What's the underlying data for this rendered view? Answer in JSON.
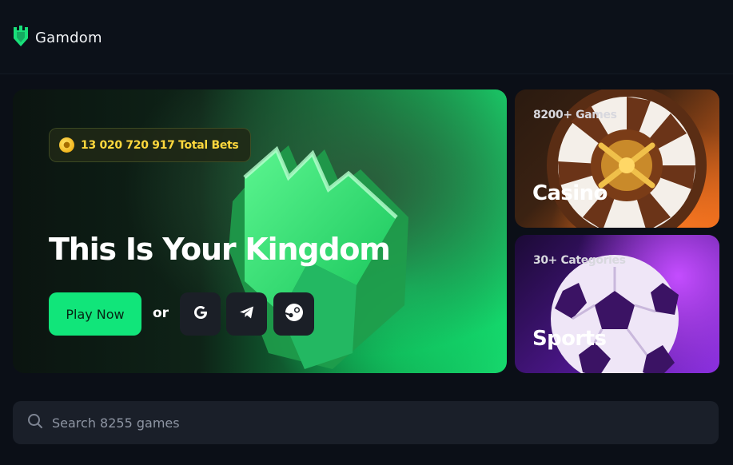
{
  "header": {
    "brand": "Gamdom"
  },
  "hero": {
    "total_bets": "13 020 720 917 Total Bets",
    "title": "This Is Your Kingdom",
    "play_button": "Play Now",
    "or": "or",
    "social_icons": [
      "google-icon",
      "telegram-icon",
      "steam-icon"
    ]
  },
  "cards": {
    "casino": {
      "subtitle": "8200+ Games",
      "title": "Casino"
    },
    "sports": {
      "subtitle": "30+ Categories",
      "title": "Sports"
    }
  },
  "search": {
    "placeholder": "Search 8255 games"
  },
  "colors": {
    "background": "#0b0f17",
    "accent_green": "#11e57a",
    "bets_text": "#ffd83d",
    "panel": "#1a1f29"
  }
}
